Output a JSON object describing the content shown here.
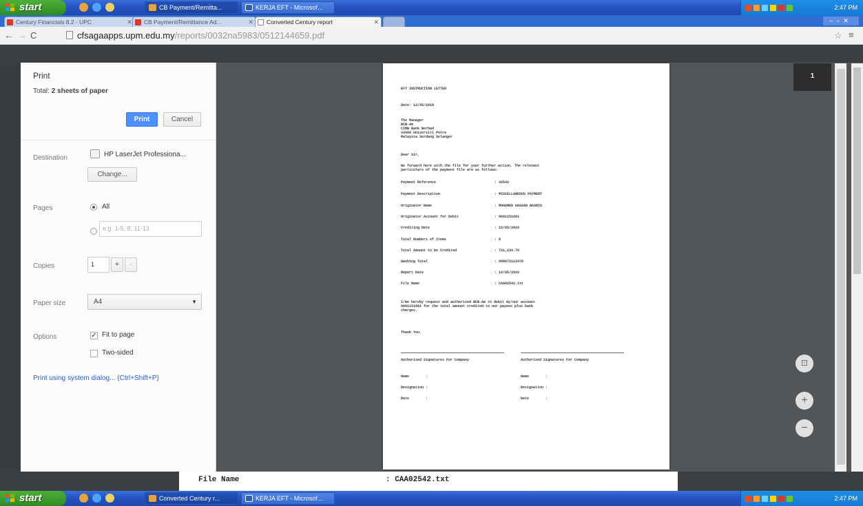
{
  "top_taskbar": {
    "start_label": "start",
    "buttons": [
      {
        "label": "CB Payment/Remitta..."
      },
      {
        "label": "KERJA EFT - Microsof..."
      }
    ],
    "clock": "2:47 PM"
  },
  "browser": {
    "tabs": [
      {
        "label": "Century Financials 8.2 - UPC"
      },
      {
        "label": "CB Payment/Remittance Ad..."
      },
      {
        "label": "Converted Century report"
      }
    ],
    "url_host": "cfsagaapps.upm.edu.my",
    "url_path": "/reports/0032na5983/0512144659.pdf"
  },
  "print_panel": {
    "title": "Print",
    "total_prefix": "Total: ",
    "total_value": "2 sheets of paper",
    "print_button": "Print",
    "cancel_button": "Cancel",
    "destination_label": "Destination",
    "destination_value": "HP LaserJet Professiona...",
    "change_button": "Change...",
    "pages_label": "Pages",
    "pages_all": "All",
    "pages_placeholder": "e.g. 1-5, 8, 11-13",
    "copies_label": "Copies",
    "copies_value": "1",
    "copies_plus": "+",
    "copies_minus": "-",
    "paper_size_label": "Paper size",
    "paper_size_value": "A4",
    "options_label": "Options",
    "fit_to_page": "Fit to page",
    "two_sided": "Two-sided",
    "system_dialog_link": "Print using system dialog... (Ctrl+Shift+P)"
  },
  "preview": {
    "page_number": "1",
    "heading": "EFT INSTRUCTION LETTER",
    "date_line": "Date: 12/05/2016",
    "address": [
      "The Manager",
      "BCB-Am",
      "CIMB Bank Berhad",
      "43400 Universiti Putra",
      "Malaysia Serdang Selangor"
    ],
    "salutation": "Dear Sir,",
    "intro": [
      "We forward here with the file for your further action. The relevant",
      "particulars of the payment file are as follows:"
    ],
    "fields": [
      {
        "label": "Payment Reference",
        "value": ": 32542"
      },
      {
        "label": "Payment Description",
        "value": ": MISCELLANEOUS PAYMENT"
      },
      {
        "label": "Originator Name",
        "value": ": MOHAMED HASSAN BASRIS"
      },
      {
        "label": "Originator Account for Debit",
        "value": ": 8001151661"
      },
      {
        "label": "Crediting Date",
        "value": ": 12/05/2016"
      },
      {
        "label": "Total Numbers of Items",
        "value": ": 8"
      },
      {
        "label": "Total Amount to be Credited",
        "value": ": 721,234.76"
      },
      {
        "label": "Hashing Total",
        "value": ": 998072113478"
      },
      {
        "label": "Report Date",
        "value": ": 12/05/2016"
      },
      {
        "label": "File Name",
        "value": ": CAA02542.txt"
      }
    ],
    "request": [
      "I/We hereby request and authorized BCB-Am to debit my/our account",
      "8001151661 for the total amount credited to our payees plus bank",
      "charges."
    ],
    "thanks": "Thank You.",
    "sig_left": "Authorised Signatures For Company",
    "sig_right": "Authorised Signatures For Company",
    "sig_rows": [
      "Name        :",
      "Designation :",
      "Date        :"
    ],
    "zoom_fit": "⊡",
    "zoom_in": "+",
    "zoom_out": "−"
  },
  "bottom_strip": {
    "label": "File Name",
    "value": ": CAA02542.txt"
  },
  "bottom_taskbar": {
    "start_label": "start",
    "buttons": [
      {
        "label": "Converted Century r..."
      },
      {
        "label": "KERJA EFT - Microsof..."
      }
    ],
    "clock": "2:47 PM"
  }
}
